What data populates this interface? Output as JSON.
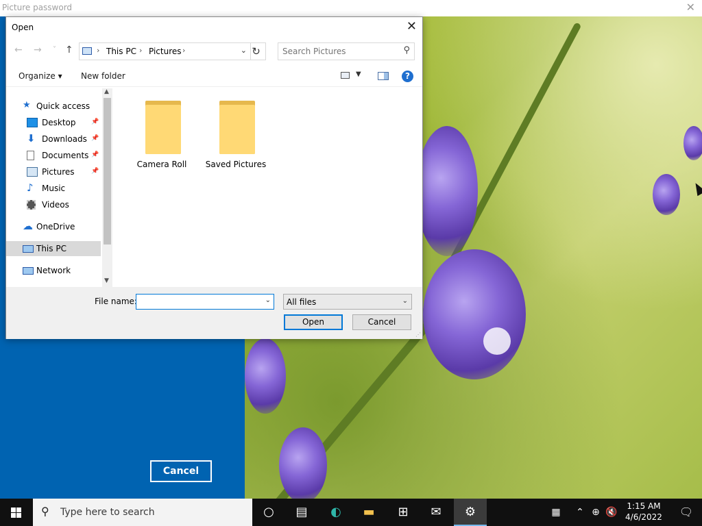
{
  "picture_password": {
    "title": "Picture password",
    "close": "✕",
    "cancel_label": "Cancel"
  },
  "dialog": {
    "title": "Open",
    "close": "✕",
    "nav": {
      "back": "←",
      "forward": "→",
      "recent": "˅",
      "up": "↑"
    },
    "address": {
      "crumbs": [
        "This PC",
        "Pictures"
      ],
      "sep": "›"
    },
    "refresh": "↻",
    "search": {
      "placeholder": "Search Pictures",
      "icon": "⚲"
    },
    "toolbar": {
      "organize": "Organize ▾",
      "new_folder": "New folder",
      "help": "?"
    },
    "nav_pane": {
      "quick_access": "Quick access",
      "items": [
        "Desktop",
        "Downloads",
        "Documents",
        "Pictures",
        "Music",
        "Videos"
      ],
      "onedrive": "OneDrive",
      "this_pc": "This PC",
      "network": "Network",
      "pin": "📌"
    },
    "folders": [
      "Camera Roll",
      "Saved Pictures"
    ],
    "file_name_label": "File name:",
    "file_name_value": "",
    "file_type": "All files",
    "open_label": "Open",
    "cancel_label": "Cancel"
  },
  "taskbar": {
    "search_placeholder": "Type here to search",
    "time": "1:15 AM",
    "date": "4/6/2022",
    "icons": [
      "cortana-icon",
      "task-view-icon",
      "edge-icon",
      "file-explorer-icon",
      "store-icon",
      "mail-icon",
      "settings-icon"
    ]
  },
  "colors": {
    "accent_blue": "#0063b1",
    "taskbar": "#101010",
    "folder_yellow": "#ffd975"
  }
}
